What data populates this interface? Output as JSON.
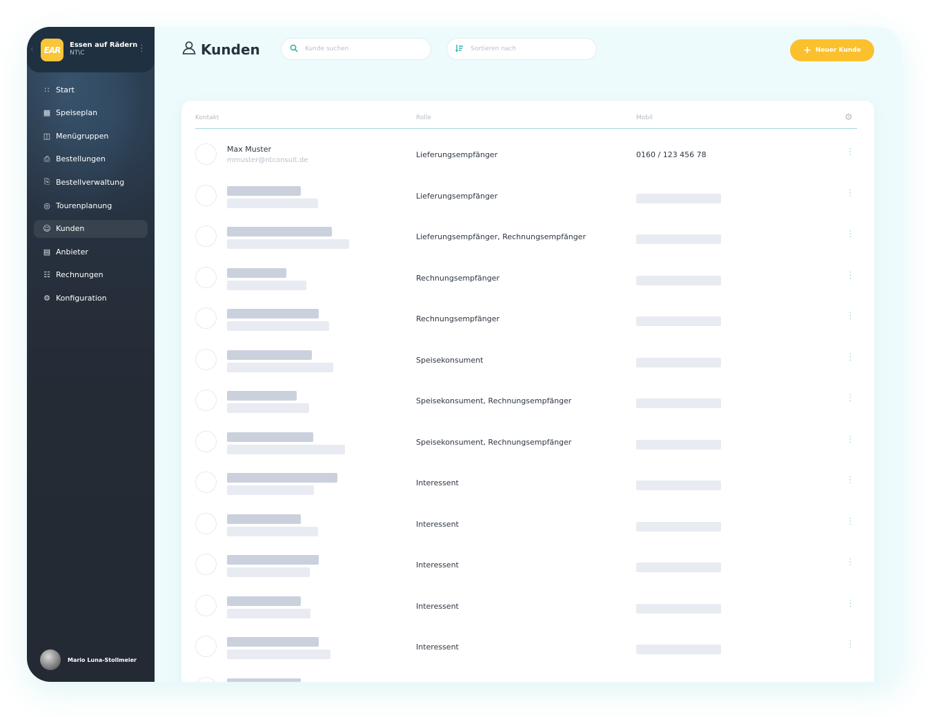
{
  "brand": {
    "logo_text": "EAR",
    "name": "Essen auf Rädern",
    "sub": "NT\\C"
  },
  "nav": [
    {
      "label": "Start",
      "icon": "grid-icon",
      "active": false
    },
    {
      "label": "Speiseplan",
      "icon": "menu-plan-icon",
      "active": false
    },
    {
      "label": "Menügruppen",
      "icon": "layout-icon",
      "active": false
    },
    {
      "label": "Bestellungen",
      "icon": "order-icon",
      "active": false
    },
    {
      "label": "Bestellverwaltung",
      "icon": "order-management-icon",
      "active": false
    },
    {
      "label": "Tourenplanung",
      "icon": "location-pin-icon",
      "active": false
    },
    {
      "label": "Kunden",
      "icon": "user-icon",
      "active": true
    },
    {
      "label": "Anbieter",
      "icon": "provider-icon",
      "active": false
    },
    {
      "label": "Rechnungen",
      "icon": "invoice-icon",
      "active": false
    },
    {
      "label": "Konfiguration",
      "icon": "gear-icon",
      "active": false
    }
  ],
  "user": {
    "name": "Mario Luna-Stollmeier"
  },
  "header": {
    "title": "Kunden",
    "search_placeholder": "Kunde suchen",
    "sort_placeholder": "Sortieren nach",
    "new_button_label": "Neuer Kunde"
  },
  "colors": {
    "accent": "#fbc02d",
    "teal": "#2fb2ad",
    "sidebar_bg": "#242a33"
  },
  "table": {
    "columns": [
      "Kontakt",
      "Rolle",
      "Mobil"
    ],
    "rows": [
      {
        "name": "Max Muster",
        "email": "mmuster@ntconsult.de",
        "role": "Lieferungsempfänger",
        "mobile": "0160 / 123 456 78"
      },
      {
        "name": "",
        "email": "",
        "role": "Lieferungsempfänger",
        "mobile": ""
      },
      {
        "name": "",
        "email": "",
        "role": "Lieferungsempfänger, Rechnungsempfänger",
        "mobile": ""
      },
      {
        "name": "",
        "email": "",
        "role": "Rechnungsempfänger",
        "mobile": ""
      },
      {
        "name": "",
        "email": "",
        "role": "Rechnungsempfänger",
        "mobile": ""
      },
      {
        "name": "",
        "email": "",
        "role": "Speisekonsument",
        "mobile": ""
      },
      {
        "name": "",
        "email": "",
        "role": "Speisekonsument, Rechnungsempfänger",
        "mobile": ""
      },
      {
        "name": "",
        "email": "",
        "role": "Speisekonsument, Rechnungsempfänger",
        "mobile": ""
      },
      {
        "name": "",
        "email": "",
        "role": "Interessent",
        "mobile": ""
      },
      {
        "name": "",
        "email": "",
        "role": "Interessent",
        "mobile": ""
      },
      {
        "name": "",
        "email": "",
        "role": "Interessent",
        "mobile": ""
      },
      {
        "name": "",
        "email": "",
        "role": "Interessent",
        "mobile": ""
      },
      {
        "name": "",
        "email": "",
        "role": "Interessent",
        "mobile": ""
      },
      {
        "name": "",
        "email": "",
        "role": "",
        "mobile": ""
      }
    ]
  }
}
